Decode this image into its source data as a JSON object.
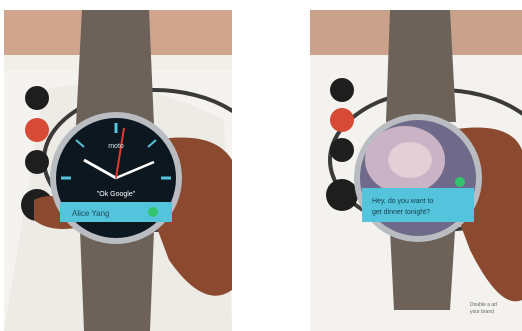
{
  "left_photo": {
    "brand": "moto",
    "voice_prompt": "\"Ok Google\"",
    "notification_name": "Alice Yang"
  },
  "right_photo": {
    "notification_line1": "Hey, do you want to",
    "notification_line2": "get dinner tonight?",
    "sign_line1": "Double a ad",
    "sign_line2": "your brand"
  },
  "colors": {
    "strap": "#6d625a",
    "bezel": "#b9bcc0",
    "notification": "#54c3dc",
    "accent_red": "#e33a2f",
    "skin": "#8b4a2f"
  }
}
